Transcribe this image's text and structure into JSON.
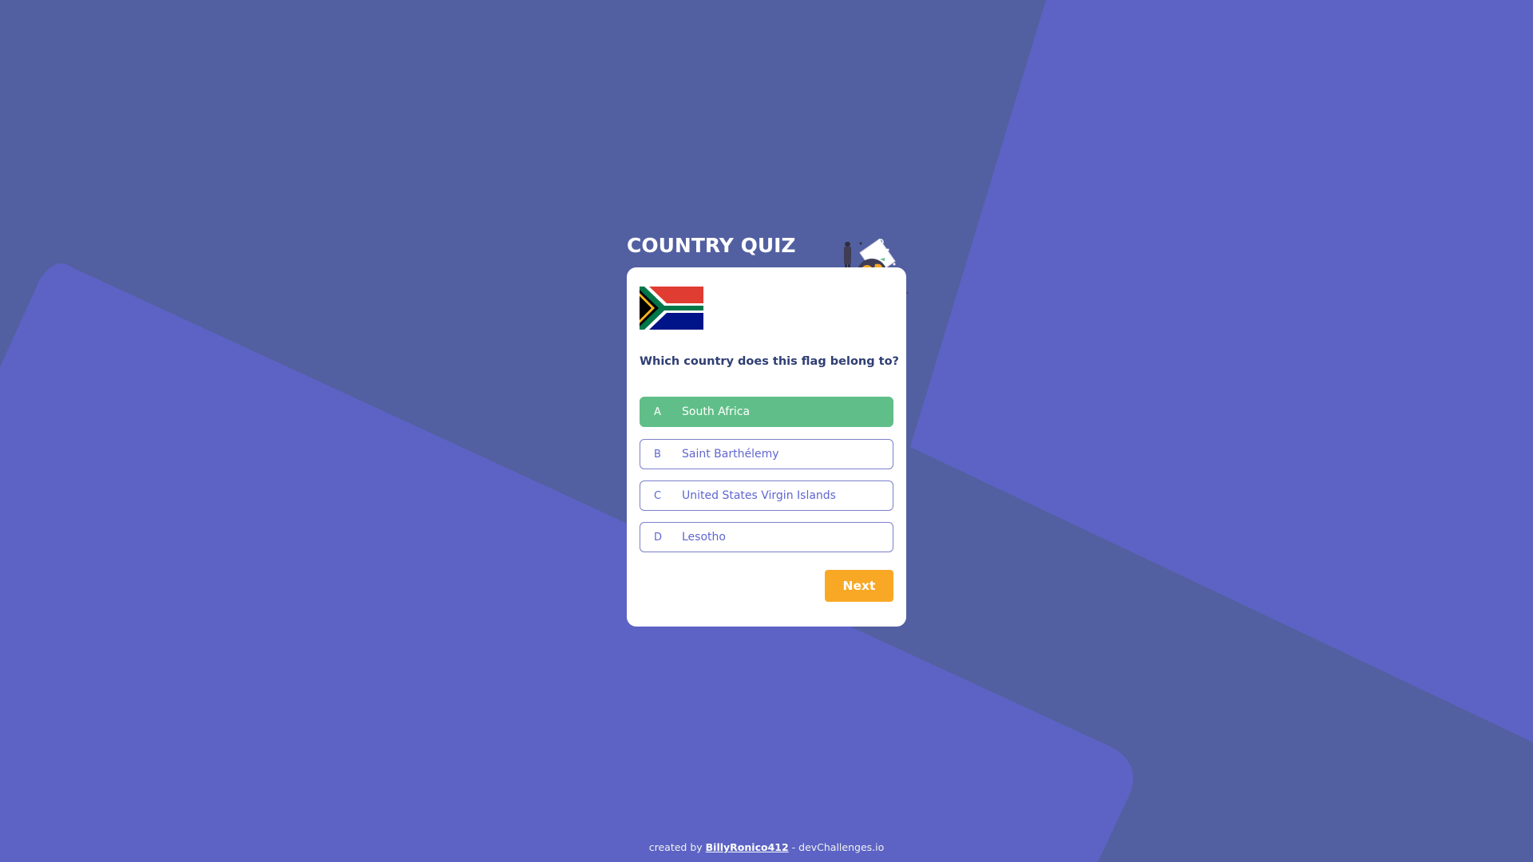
{
  "app": {
    "title": "COUNTRY QUIZ"
  },
  "quiz": {
    "question": "Which country does this flag belong to?",
    "flag_icon": "south-africa-flag-icon",
    "options": [
      {
        "letter": "A",
        "label": "South Africa",
        "state": "correct"
      },
      {
        "letter": "B",
        "label": "Saint Barthélemy",
        "state": "default"
      },
      {
        "letter": "C",
        "label": "United States Virgin Islands",
        "state": "default"
      },
      {
        "letter": "D",
        "label": "Lesotho",
        "state": "default"
      }
    ],
    "next_label": "Next"
  },
  "footer": {
    "prefix": "created by ",
    "author": "BillyRonico412",
    "suffix": " - devChallenges.io"
  },
  "colors": {
    "background_dark": "#5260a1",
    "background_light": "#5c63c4",
    "correct": "#60bf88",
    "accent": "#f9a826",
    "option_border": "#7a80c9",
    "option_text": "#6066d0",
    "question_text": "#2f3e73"
  }
}
